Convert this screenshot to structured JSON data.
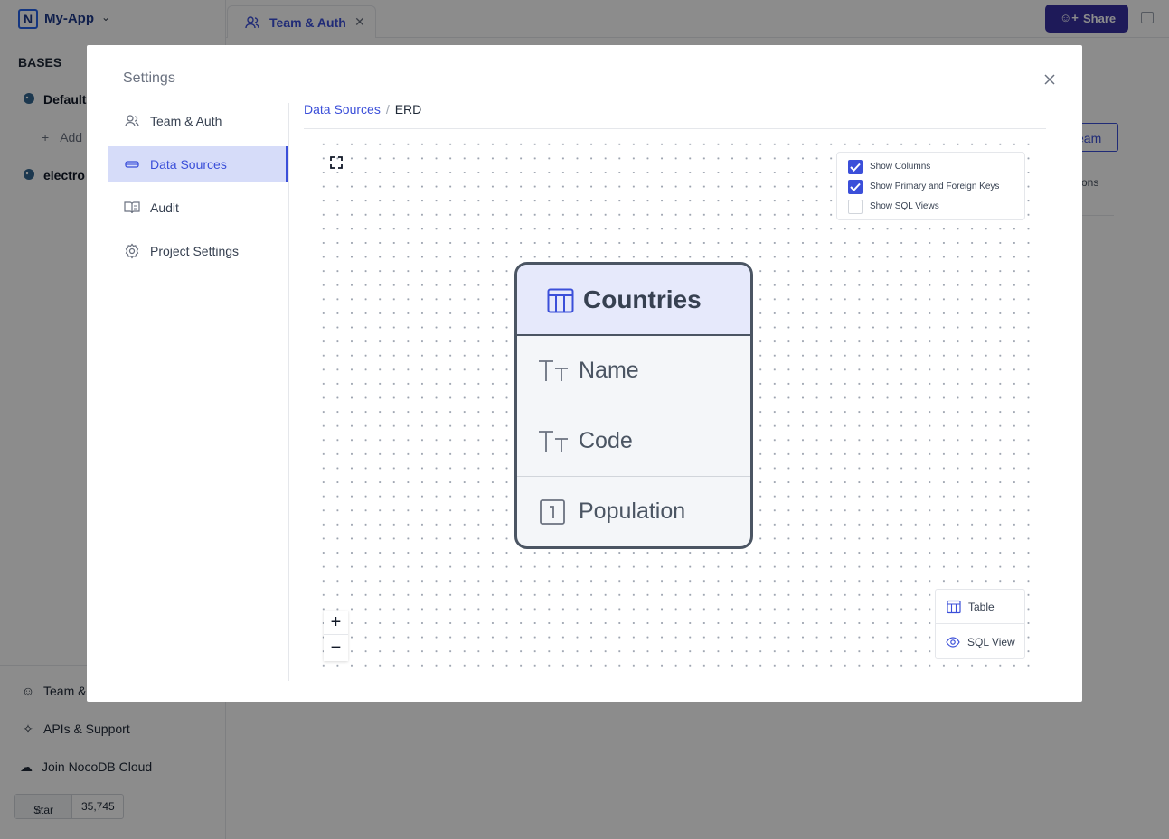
{
  "app": {
    "name": "My-App",
    "logo_letter": "N",
    "open_tab": "Team & Auth",
    "share_label": "Share"
  },
  "sidebar": {
    "bases_heading": "BASES",
    "bases": [
      {
        "label": "Default"
      },
      {
        "label": "electro"
      }
    ],
    "add_label": "Add",
    "bottom_links": [
      {
        "label": "Team &",
        "icon": "users-icon"
      },
      {
        "label": "APIs & Support",
        "icon": "support-icon"
      },
      {
        "label": "Join NocoDB Cloud",
        "icon": "cloud-icon"
      }
    ],
    "star_label": "Star",
    "star_count": "35,745"
  },
  "background": {
    "team_button": "eam",
    "options_label": "tions"
  },
  "modal": {
    "title": "Settings",
    "nav": [
      {
        "label": "Team & Auth",
        "icon": "users-icon",
        "active": false
      },
      {
        "label": "Data Sources",
        "icon": "database-icon",
        "active": true
      },
      {
        "label": "Audit",
        "icon": "book-icon",
        "active": false
      },
      {
        "label": "Project Settings",
        "icon": "gear-icon",
        "active": false
      }
    ],
    "breadcrumb": {
      "link": "Data Sources",
      "separator": "/",
      "current": "ERD"
    },
    "erd": {
      "options": [
        {
          "label": "Show Columns",
          "checked": true
        },
        {
          "label": "Show Primary and Foreign Keys",
          "checked": true
        },
        {
          "label": "Show SQL Views",
          "checked": false
        }
      ],
      "table": {
        "name": "Countries",
        "columns": [
          {
            "name": "Name",
            "type": "text"
          },
          {
            "name": "Code",
            "type": "text"
          },
          {
            "name": "Population",
            "type": "number"
          }
        ]
      },
      "zoom_in": "+",
      "zoom_out": "−",
      "type_legend": [
        {
          "label": "Table",
          "icon": "table-icon"
        },
        {
          "label": "SQL View",
          "icon": "eye-icon"
        }
      ]
    }
  },
  "colors": {
    "accent": "#3b4fd9",
    "active_nav_bg": "#d6dcf9",
    "share_bg": "#3730a3",
    "erd_header_bg": "#e6e9fb",
    "erd_border": "#4b5563"
  }
}
